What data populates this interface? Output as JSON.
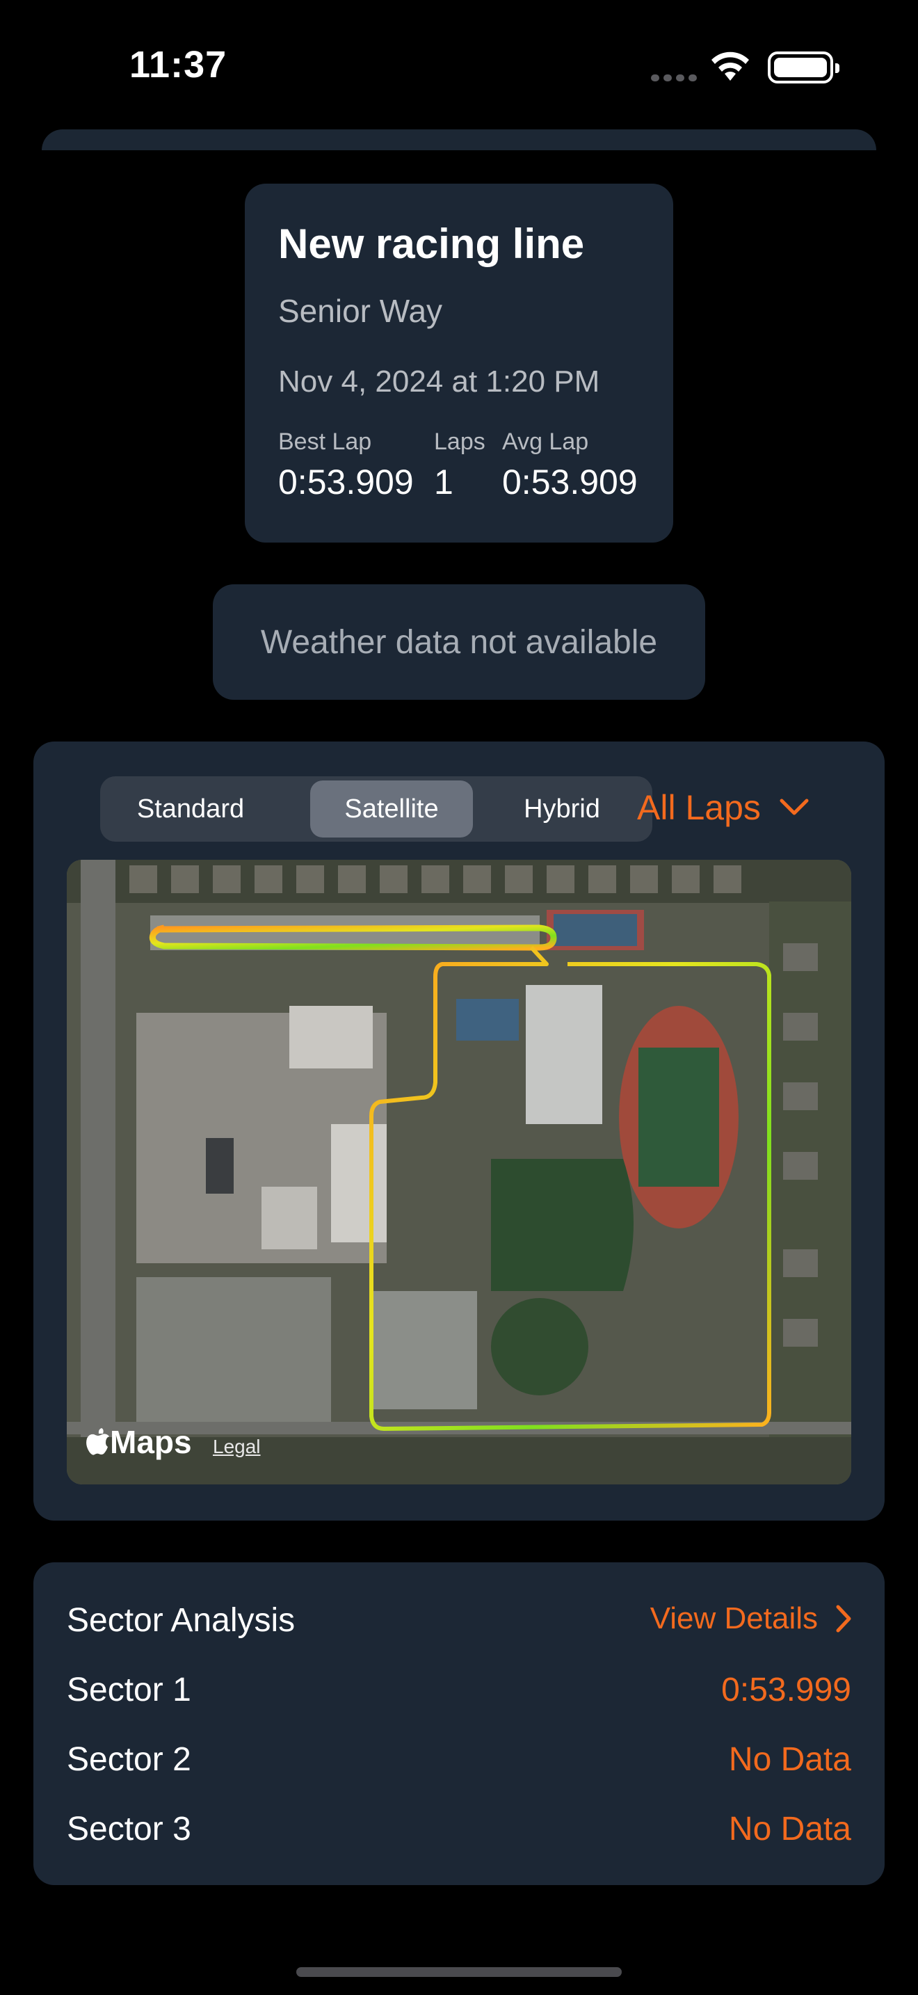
{
  "status_bar": {
    "time": "11:37"
  },
  "summary": {
    "title": "New racing line",
    "track": "Senior Way",
    "date": "Nov 4, 2024 at 1:20 PM",
    "best_lap_label": "Best Lap",
    "best_lap_value": "0:53.909",
    "laps_label": "Laps",
    "laps_value": "1",
    "avg_lap_label": "Avg Lap",
    "avg_lap_value": "0:53.909"
  },
  "weather": {
    "message": "Weather data not available"
  },
  "map": {
    "segments": [
      "Standard",
      "Satellite",
      "Hybrid"
    ],
    "selected_segment": "Satellite",
    "lap_filter": "All Laps",
    "attribution": "Maps",
    "legal": "Legal"
  },
  "sectors": {
    "title": "Sector Analysis",
    "details_link": "View Details",
    "rows": [
      {
        "label": "Sector 1",
        "value": "0:53.999"
      },
      {
        "label": "Sector 2",
        "value": "No Data"
      },
      {
        "label": "Sector 3",
        "value": "No Data"
      }
    ]
  },
  "colors": {
    "accent": "#f36a1e",
    "card": "#1c2735",
    "background": "#000000"
  }
}
